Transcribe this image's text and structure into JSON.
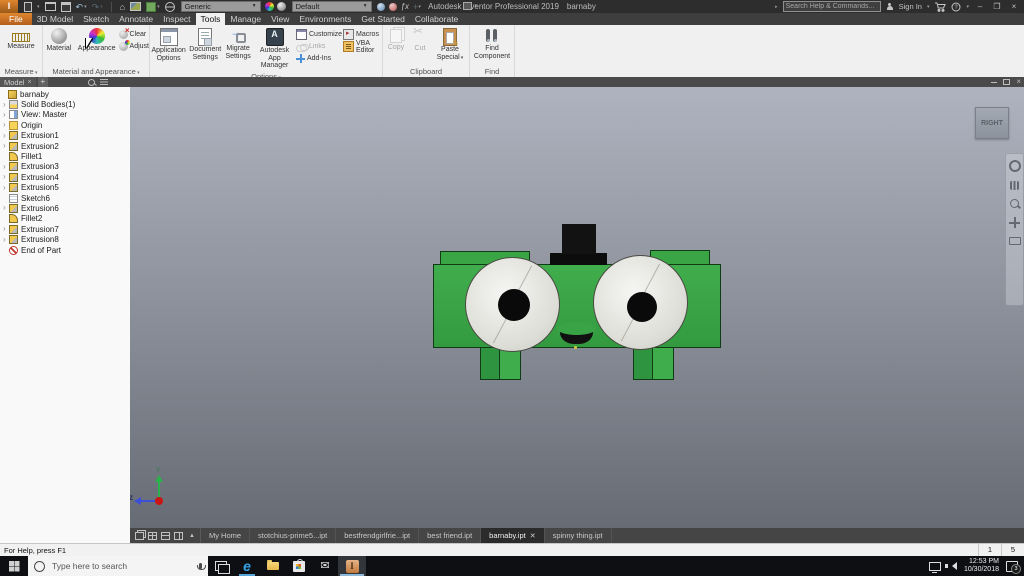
{
  "titlebar": {
    "app_title": "Autodesk Inventor Professional 2019",
    "doc_title": "barnaby",
    "material_select": "Generic",
    "appearance_select": "Default",
    "help_search_placeholder": "Search Help & Commands...",
    "sign_in_label": "Sign In"
  },
  "ribbon": {
    "tabs": [
      {
        "label": "File",
        "file": true
      },
      {
        "label": "3D Model"
      },
      {
        "label": "Sketch"
      },
      {
        "label": "Annotate"
      },
      {
        "label": "Inspect"
      },
      {
        "label": "Tools",
        "active": true
      },
      {
        "label": "Manage"
      },
      {
        "label": "View"
      },
      {
        "label": "Environments"
      },
      {
        "label": "Get Started"
      },
      {
        "label": "Collaborate"
      }
    ],
    "measure": {
      "button": "Measure",
      "group": "Measure"
    },
    "material": {
      "material": "Material",
      "appearance": "Appearance",
      "clear": "Clear",
      "adjust": "Adjust",
      "group": "Material and Appearance"
    },
    "options": {
      "application_options": "Application Options",
      "document_settings": "Document Settings",
      "migrate_settings": "Migrate Settings",
      "app_manager": "Autodesk App Manager",
      "customize": "Customize",
      "links": "Links",
      "add_ins": "Add-Ins",
      "macros": "Macros",
      "vba_editor": "VBA Editor",
      "group": "Options"
    },
    "clipboard": {
      "copy": "Copy",
      "cut": "Cut",
      "paste_special": "Paste Special",
      "group": "Clipboard"
    },
    "find": {
      "find_component": "Find Component",
      "group": "Find"
    }
  },
  "browser": {
    "panel_tab": "Model",
    "items": [
      {
        "label": "barnaby",
        "icon": "part",
        "root": true
      },
      {
        "label": "Solid Bodies(1)",
        "icon": "solidbodies",
        "expandable": true
      },
      {
        "label": "View: Master",
        "icon": "viewrep",
        "expandable": true
      },
      {
        "label": "Origin",
        "icon": "origin",
        "expandable": true
      },
      {
        "label": "Extrusion1",
        "icon": "extrusion",
        "expandable": true
      },
      {
        "label": "Extrusion2",
        "icon": "extrusion",
        "expandable": true
      },
      {
        "label": "Fillet1",
        "icon": "fillet"
      },
      {
        "label": "Extrusion3",
        "icon": "extrusion",
        "expandable": true
      },
      {
        "label": "Extrusion4",
        "icon": "extrusion",
        "expandable": true
      },
      {
        "label": "Extrusion5",
        "icon": "extrusion",
        "expandable": true
      },
      {
        "label": "Sketch6",
        "icon": "sketch"
      },
      {
        "label": "Extrusion6",
        "icon": "extrusion",
        "expandable": true
      },
      {
        "label": "Fillet2",
        "icon": "fillet"
      },
      {
        "label": "Extrusion7",
        "icon": "extrusion",
        "expandable": true
      },
      {
        "label": "Extrusion8",
        "icon": "extrusion",
        "expandable": true
      },
      {
        "label": "End of Part",
        "icon": "endofpart"
      }
    ]
  },
  "viewport": {
    "viewcube_face": "RIGHT",
    "axis_y_label": "Y",
    "axis_z_label": "Z"
  },
  "doc_tabs": [
    {
      "label": "My Home"
    },
    {
      "label": "stotchius-prime5...ipt"
    },
    {
      "label": "bestfrendgirlfrie...ipt"
    },
    {
      "label": "best friend.ipt"
    },
    {
      "label": "barnaby.ipt",
      "active": true,
      "closable": true
    },
    {
      "label": "spinny thing.ipt"
    }
  ],
  "statusbar": {
    "help_text": "For Help, press F1",
    "cell_1": "1",
    "cell_2": "5"
  },
  "taskbar": {
    "search_placeholder": "Type here to search",
    "clock_time": "12:53 PM",
    "clock_date": "10/30/2018",
    "notification_badge": "3"
  },
  "colors": {
    "accent_orange": "#d97b2d",
    "model_green": "#36a341",
    "viewport_top": "#aeb3bf",
    "viewport_bottom": "#666b74"
  }
}
